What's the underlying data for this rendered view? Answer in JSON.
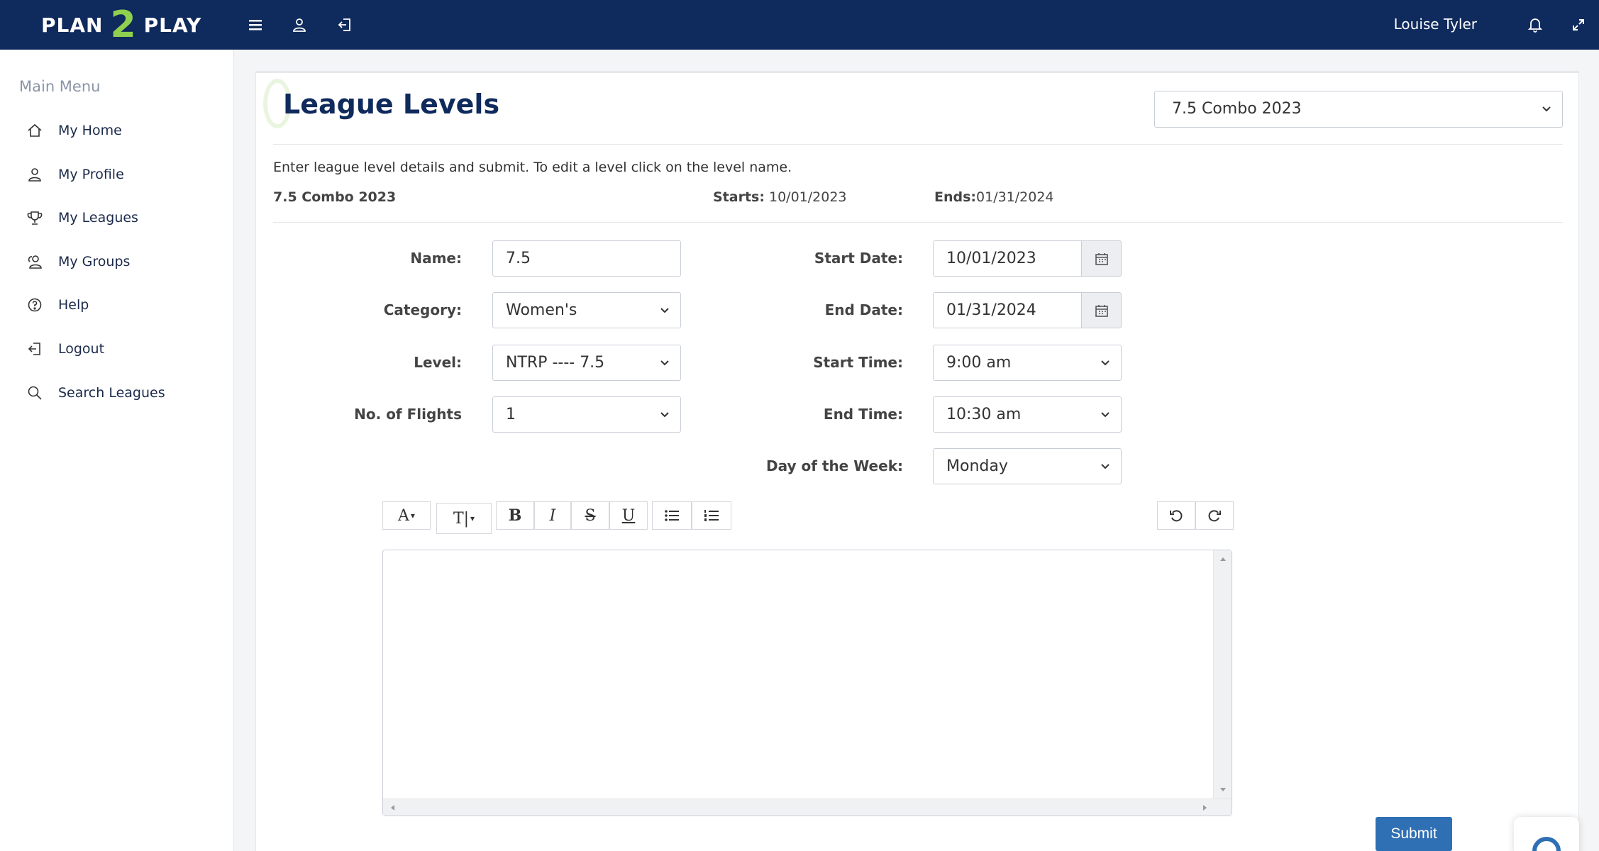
{
  "topbar": {
    "logo_left": "PLAN",
    "logo_mid": "2",
    "logo_right": "PLAY",
    "user_name": "Louise Tyler",
    "icons": [
      "hamburger-icon",
      "user-icon",
      "logout-icon",
      "bell-icon",
      "expand-icon"
    ]
  },
  "sidebar": {
    "title": "Main Menu",
    "items": [
      {
        "label": "My Home",
        "icon": "home-icon"
      },
      {
        "label": "My Profile",
        "icon": "user-icon"
      },
      {
        "label": "My Leagues",
        "icon": "trophy-icon"
      },
      {
        "label": "My Groups",
        "icon": "group-icon"
      },
      {
        "label": "Help",
        "icon": "help-icon"
      },
      {
        "label": "Logout",
        "icon": "logout-icon"
      },
      {
        "label": "Search Leagues",
        "icon": "search-icon"
      }
    ]
  },
  "page": {
    "title": "League Levels",
    "league_select": "7.5 Combo 2023",
    "intro": "Enter league level details and submit. To edit a level click on the level name.",
    "league_name": "7.5 Combo 2023",
    "starts_label": "Starts:",
    "starts_value": "10/01/2023",
    "ends_label": "Ends:",
    "ends_value": "01/31/2024"
  },
  "form": {
    "name_label": "Name:",
    "name_value": "7.5",
    "category_label": "Category:",
    "category_value": "Women's",
    "level_label": "Level:",
    "level_value": "NTRP ---- 7.5",
    "flights_label": "No. of Flights",
    "flights_value": "1",
    "start_date_label": "Start Date:",
    "start_date_value": "10/01/2023",
    "end_date_label": "End Date:",
    "end_date_value": "01/31/2024",
    "start_time_label": "Start Time:",
    "start_time_value": "9:00 am",
    "end_time_label": "End Time:",
    "end_time_value": "10:30 am",
    "dow_label": "Day of the Week:",
    "dow_value": "Monday"
  },
  "editor": {
    "font_btn": "A",
    "size_btn": "T|",
    "bold_btn": "B",
    "italic_btn": "I",
    "strike_btn": "S",
    "underline_btn": "U"
  },
  "submit_label": "Submit",
  "colors": {
    "topbar": "#0f2a5c",
    "accent_green": "#8fd14f",
    "submit": "#2f6fb3"
  }
}
